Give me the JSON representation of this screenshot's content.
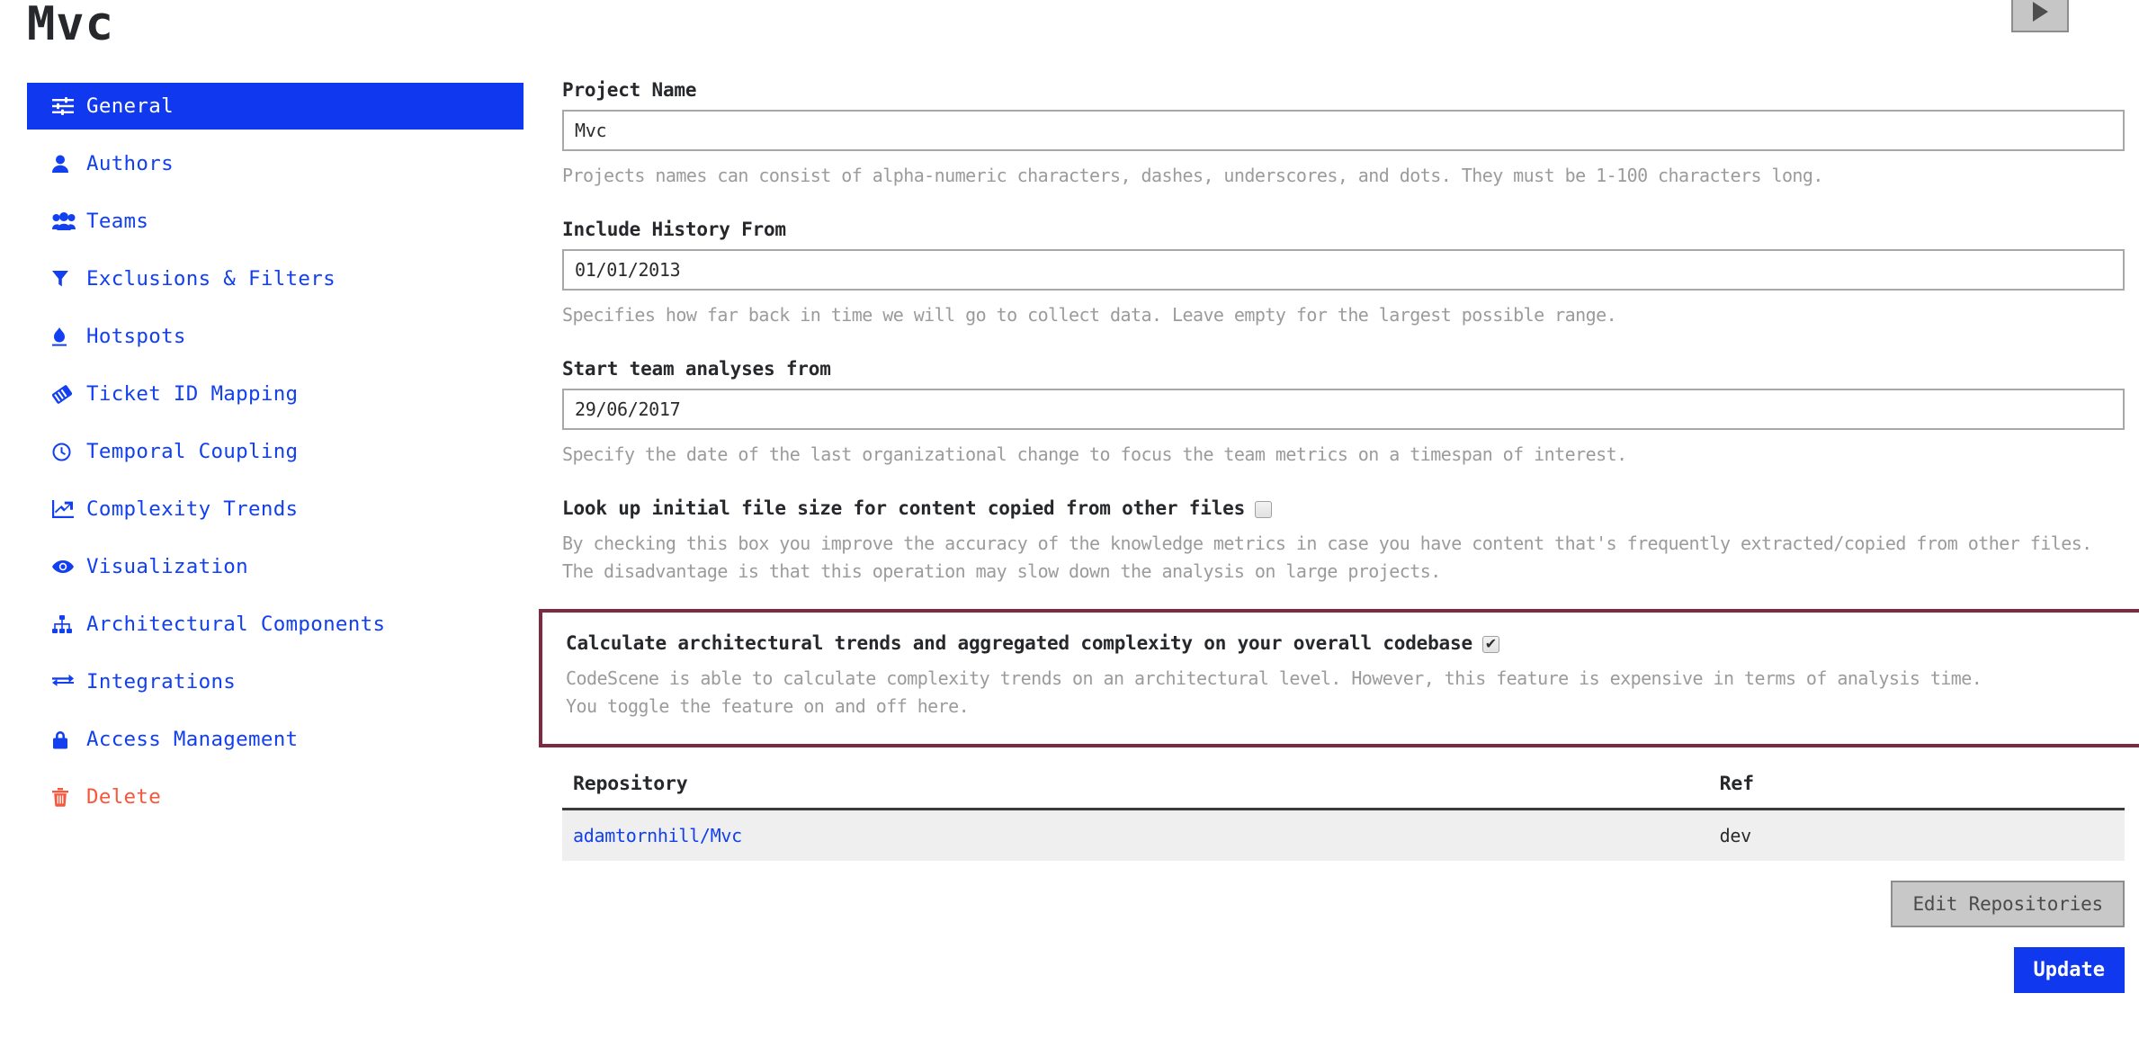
{
  "header": {
    "title": "Mvc",
    "play_button_icon": "play-icon"
  },
  "sidebar": {
    "items": [
      {
        "label": "General",
        "icon": "sliders-icon",
        "active": true
      },
      {
        "label": "Authors",
        "icon": "user-icon",
        "active": false
      },
      {
        "label": "Teams",
        "icon": "users-icon",
        "active": false
      },
      {
        "label": "Exclusions & Filters",
        "icon": "filter-icon",
        "active": false
      },
      {
        "label": "Hotspots",
        "icon": "flame-icon",
        "active": false
      },
      {
        "label": "Ticket ID Mapping",
        "icon": "tag-icon",
        "active": false
      },
      {
        "label": "Temporal Coupling",
        "icon": "clock-icon",
        "active": false
      },
      {
        "label": "Complexity Trends",
        "icon": "chart-line-icon",
        "active": false
      },
      {
        "label": "Visualization",
        "icon": "eye-icon",
        "active": false
      },
      {
        "label": "Architectural Components",
        "icon": "sitemap-icon",
        "active": false
      },
      {
        "label": "Integrations",
        "icon": "exchange-icon",
        "active": false
      },
      {
        "label": "Access Management",
        "icon": "lock-icon",
        "active": false
      },
      {
        "label": "Delete",
        "icon": "trash-icon",
        "active": false,
        "danger": true
      }
    ]
  },
  "form": {
    "project_name": {
      "label": "Project Name",
      "value": "Mvc",
      "help": "Projects names can consist of alpha-numeric characters, dashes, underscores, and dots. They must be 1-100 characters long."
    },
    "include_history_from": {
      "label": "Include History From",
      "value": "01/01/2013",
      "help": "Specifies how far back in time we will go to collect data. Leave empty for the largest possible range."
    },
    "start_team_analyses_from": {
      "label": "Start team analyses from",
      "value": "29/06/2017",
      "help": "Specify the date of the last organizational change to focus the team metrics on a timespan of interest."
    },
    "lookup_initial_file_size": {
      "label": "Look up initial file size for content copied from other files",
      "checked": false,
      "help": "By checking this box you improve the accuracy of the knowledge metrics in case you have content that's frequently extracted/copied from other files. The disadvantage is that this operation may slow down the analysis on large projects."
    },
    "calculate_architectural_trends": {
      "label": "Calculate architectural trends and aggregated complexity on your overall codebase",
      "checked": true,
      "help": "CodeScene is able to calculate complexity trends on an architectural level. However, this feature is expensive in terms of analysis time.\nYou toggle the feature on and off here."
    }
  },
  "repositories": {
    "columns": [
      "Repository",
      "Ref"
    ],
    "rows": [
      {
        "repository": "adamtornhill/Mvc",
        "ref": "dev"
      }
    ],
    "edit_button_label": "Edit Repositories"
  },
  "actions": {
    "update_label": "Update"
  },
  "colors": {
    "accent_blue": "#1038ef",
    "link_blue": "#1240f0",
    "danger_red": "#f8573b",
    "highlight_border": "#7d2a42",
    "help_gray": "#9b9b9b"
  }
}
